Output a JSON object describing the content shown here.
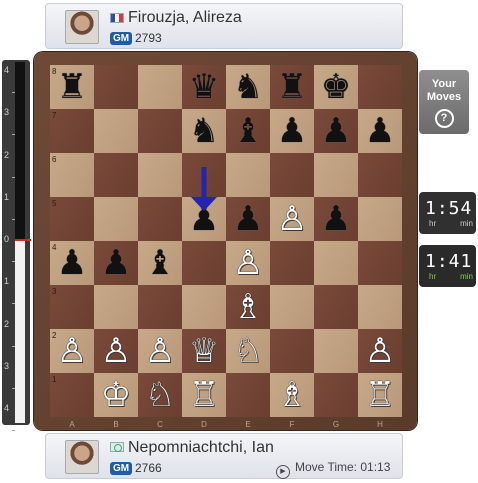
{
  "top_player": {
    "name": "Firouzja, Alireza",
    "title": "GM",
    "rating": "2793",
    "flag_icon": "france-flag-icon"
  },
  "bottom_player": {
    "name": "Nepomniachtchi, Ian",
    "title": "GM",
    "rating": "2766",
    "flag_icon": "fide-flag-icon",
    "move_time_label": "Move Time: 01:13"
  },
  "eval_bar": {
    "ticks": [
      "4",
      "3",
      "2",
      "1",
      "0",
      "1",
      "2",
      "3",
      "4"
    ],
    "evaluation": 0
  },
  "files": [
    "A",
    "B",
    "C",
    "D",
    "E",
    "F",
    "G",
    "H"
  ],
  "ranks": [
    "8",
    "7",
    "6",
    "5",
    "4",
    "3",
    "2",
    "1"
  ],
  "board": [
    [
      "bR",
      "",
      "",
      "bQ",
      "bN",
      "bR",
      "bK",
      ""
    ],
    [
      "",
      "",
      "",
      "bN",
      "bB",
      "bP",
      "bP",
      "bP"
    ],
    [
      "",
      "",
      "",
      "",
      "",
      "",
      "",
      ""
    ],
    [
      "",
      "",
      "",
      "bP",
      "bP",
      "wP",
      "bP",
      ""
    ],
    [
      "bP",
      "bP",
      "bB",
      "",
      "wP",
      "",
      "",
      ""
    ],
    [
      "",
      "",
      "",
      "",
      "wB",
      "",
      "",
      ""
    ],
    [
      "wP",
      "wP",
      "wP",
      "wQ",
      "wN",
      "",
      "",
      "wP"
    ],
    [
      "",
      "wK",
      "wN",
      "wR",
      "",
      "wB",
      "",
      "wR"
    ]
  ],
  "last_move": {
    "from": "d6",
    "to": "d5"
  },
  "your_moves": {
    "line1": "Your",
    "line2": "Moves",
    "help": "?"
  },
  "clocks": {
    "top": {
      "time": "1:54",
      "hr": "hr",
      "min": "min"
    },
    "bottom": {
      "time": "1:41",
      "hr": "hr",
      "min": "min"
    }
  },
  "colors": {
    "arrow": "#2424b0",
    "light_square": "#c7a98a",
    "dark_square": "#6e4234",
    "accent_clock": "#7fd24a"
  }
}
